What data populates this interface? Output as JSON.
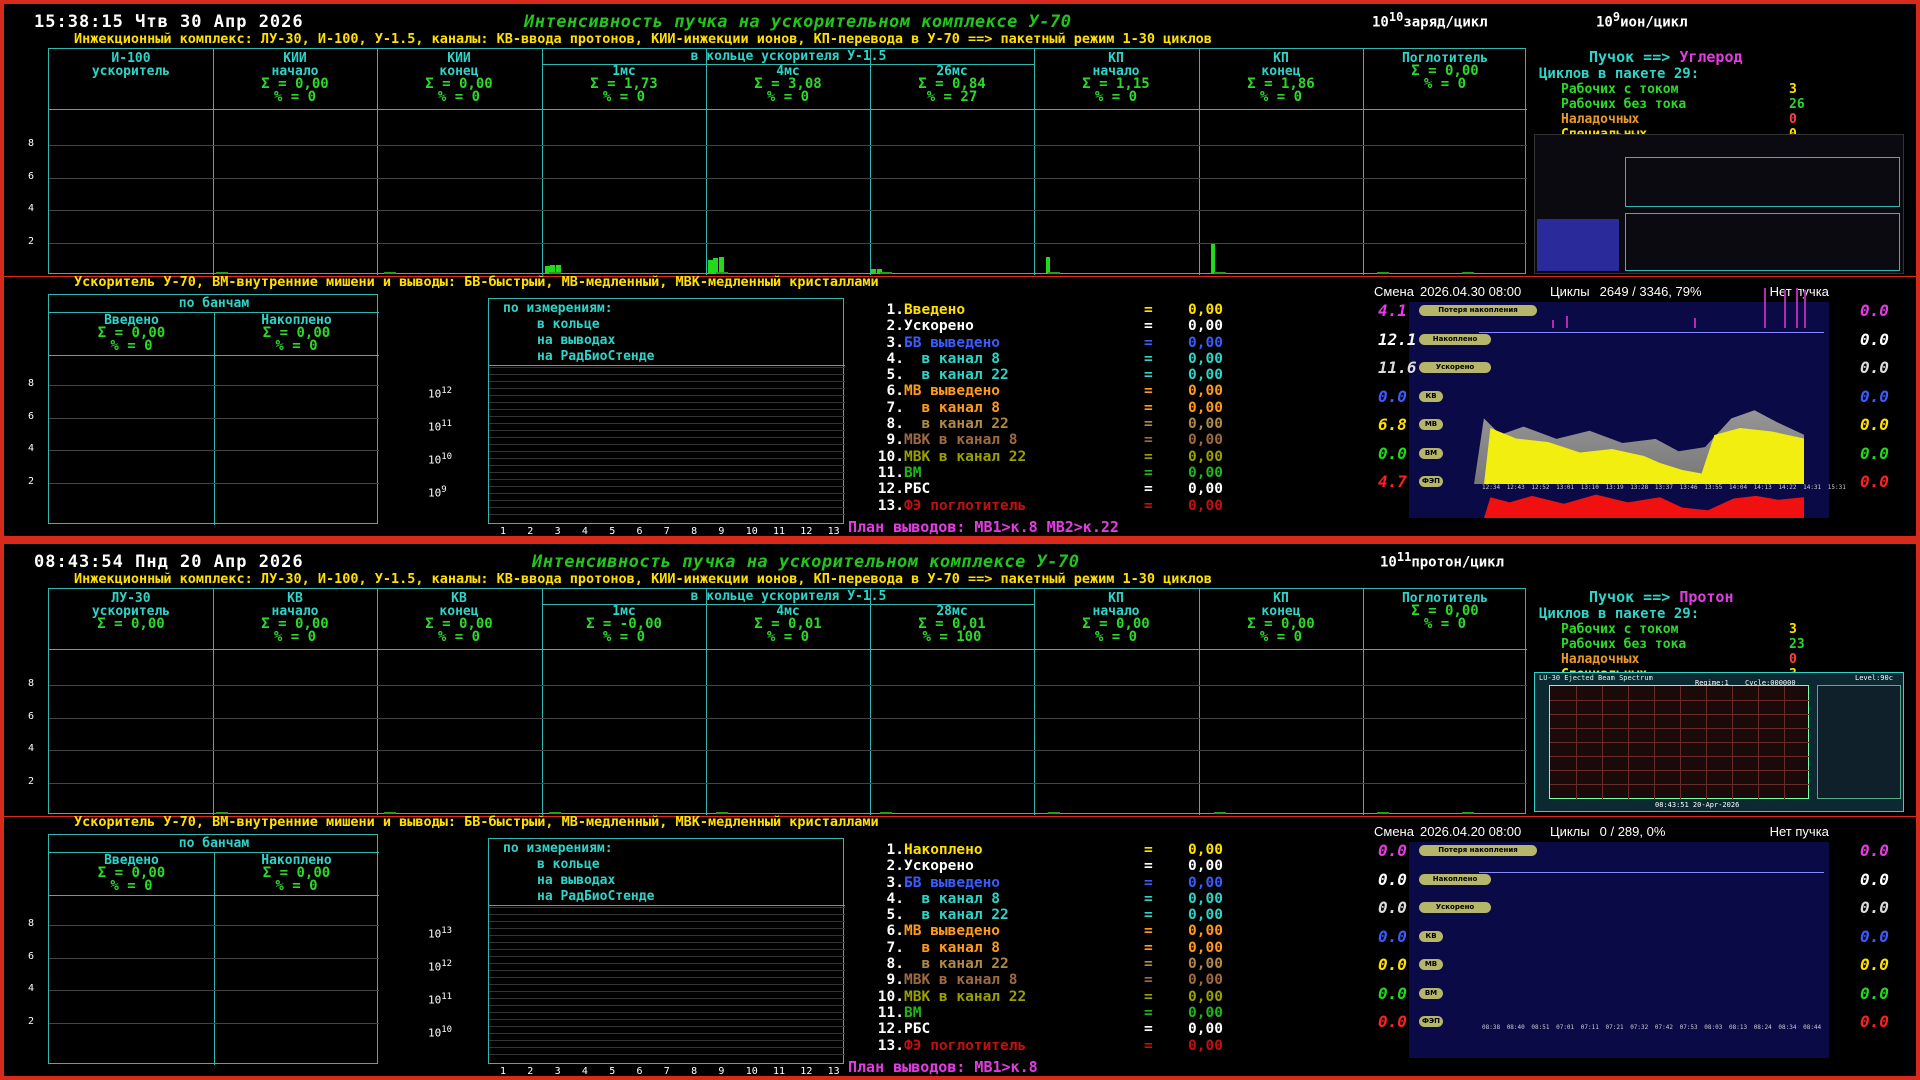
{
  "colors": {
    "frame": "#d82a1c",
    "green": "#22c51d",
    "cyan": "#2fd3c8",
    "yellow": "#ffe000",
    "magenta": "#e23de0"
  },
  "panels": [
    {
      "time": "15:38:15 Чтв 30 Апр 2026",
      "title": "Интенсивность пучка на ускорительном комплексе У-70",
      "unit1_base": "10",
      "unit1_exp": "10",
      "unit1_label": "заряд/цикл",
      "unit2_base": "10",
      "unit2_exp": "9",
      "unit2_label": "ион/цикл",
      "inj_line": "Инжекционный комплекс: ЛУ-30, И-100, У-1.5, каналы: КВ-ввода протонов, КИИ-инжекции ионов, КП-перевода в У-70 ==> пакетный режим 1-30 циклов",
      "ring_header": "в кольце ускорителя У-1.5",
      "columns": [
        {
          "name1": "И-100",
          "name2": "ускоритель",
          "sum": "",
          "pct": ""
        },
        {
          "name1": "КИИ",
          "name2": "начало",
          "sum": "Σ = 0,00",
          "pct": "% =   0"
        },
        {
          "name1": "КИИ",
          "name2": "конец",
          "sum": "Σ = 0,00",
          "pct": "% =   0"
        },
        {
          "name1": "",
          "name2": "1мс",
          "sum": "Σ = 1,73",
          "pct": "% =   0"
        },
        {
          "name1": "",
          "name2": "4мс",
          "sum": "Σ = 3,08",
          "pct": "% =   0"
        },
        {
          "name1": "",
          "name2": "26мс",
          "sum": "Σ = 0,84",
          "pct": "% =  27"
        },
        {
          "name1": "КП",
          "name2": "начало",
          "sum": "Σ = 1,15",
          "pct": "% =   0"
        },
        {
          "name1": "КП",
          "name2": "конец",
          "sum": "Σ = 1,86",
          "pct": "% =   0"
        },
        {
          "name1": "Поглотитель",
          "name2": "",
          "sum": "Σ = 0,00",
          "pct": "% =   0"
        }
      ],
      "y_ticks": [
        "8",
        "6",
        "4",
        "2"
      ],
      "beam": {
        "label": "Пучок ==> ",
        "particle": "Углерод"
      },
      "cycles": {
        "title": "Циклов в пакете 29:",
        "rows": [
          {
            "label": "Рабочих с током",
            "value": "3",
            "color": "#ffe000",
            "lcolor": "#2cd82a"
          },
          {
            "label": "Рабочих без тока",
            "value": "26",
            "color": "#2cd82a",
            "lcolor": "#2cd82a"
          },
          {
            "label": "Наладочных",
            "value": "0",
            "color": "#ff4040",
            "lcolor": "#e79a2a"
          },
          {
            "label": "Специальных",
            "value": "0",
            "color": "#ffe000",
            "lcolor": "#ffe000"
          }
        ]
      },
      "acc_line": "Ускоритель У-70, ВМ-внутренние мишени и выводы: БВ-быстрый, МВ-медленный, МВК-медленный кристаллами",
      "bunches": {
        "title": "по банчам",
        "col1": "Введено",
        "col2": "Накоплено",
        "sum1": "Σ = 0,00",
        "pct1": "% =   0",
        "sum2": "Σ = 0,00",
        "pct2": "% =   0"
      },
      "meas": {
        "title": "по измерениям:",
        "l1": "в кольце",
        "l2": "на выводах",
        "l3": "на РадБиоСтенде"
      },
      "log_exps": [
        "12",
        "11",
        "10",
        "9"
      ],
      "x_ticks": [
        "1",
        "2",
        "3",
        "4",
        "5",
        "6",
        "7",
        "8",
        "9",
        "10",
        "11",
        "12",
        "13"
      ],
      "list": [
        {
          "n": "1.",
          "label": "Введено",
          "val": "0,00",
          "c": "#ffe000"
        },
        {
          "n": "2.",
          "label": "Ускорено",
          "val": "0,00",
          "c": "#ffffff"
        },
        {
          "n": "3.",
          "label": "БВ выведено",
          "val": "0,00",
          "c": "#3a5cff"
        },
        {
          "n": "4.",
          "label": "  в канал 8",
          "val": "0,00",
          "c": "#2fd3c8"
        },
        {
          "n": "5.",
          "label": "  в канал 22",
          "val": "0,00",
          "c": "#2fd3c8"
        },
        {
          "n": "6.",
          "label": "МВ выведено",
          "val": "0,00",
          "c": "#ff9a1c"
        },
        {
          "n": "7.",
          "label": "  в канал 8",
          "val": "0,00",
          "c": "#ff9a1c"
        },
        {
          "n": "8.",
          "label": "  в канал 22",
          "val": "0,00",
          "c": "#b0884a"
        },
        {
          "n": "9.",
          "label": "МВК в канал 8",
          "val": "0,00",
          "c": "#a06a40"
        },
        {
          "n": "10.",
          "label": "МВК в канал 22",
          "val": "0,00",
          "c": "#9aa000"
        },
        {
          "n": "11.",
          "label": "ВМ",
          "val": "0,00",
          "c": "#1eb81a"
        },
        {
          "n": "12.",
          "label": "РБС",
          "val": "0,00",
          "c": "#ffffff"
        },
        {
          "n": "13.",
          "label": "ФЭ поглотитель",
          "val": "0,00",
          "c": "#c01010"
        }
      ],
      "plan": "План выводов: МВ1>к.8 МВ2>к.22",
      "shift": {
        "label": "Смена",
        "date": "2026.04.30 08:00",
        "cyc_label": "Циклы",
        "cyc": "2649 / 3346,  79%",
        "status": "Нет пучка"
      },
      "plot_rows": [
        {
          "left": "4.1",
          "pill": "Потеря накопления",
          "right": "0.0",
          "lc": "#e23de0",
          "rc": "#e23de0"
        },
        {
          "left": "12.1",
          "pill": "Накоплено",
          "right": "0.0",
          "lc": "#ffffff",
          "rc": "#ffffff"
        },
        {
          "left": "11.6",
          "pill": "Ускорено",
          "right": "0.0",
          "lc": "#dddddd",
          "rc": "#dddddd"
        },
        {
          "left": "0.0",
          "pill": "КВ",
          "right": "0.0",
          "lc": "#3a5cff",
          "rc": "#3a5cff"
        },
        {
          "left": "6.8",
          "pill": "МВ",
          "right": "0.0",
          "lc": "#ffe000",
          "rc": "#ffe000"
        },
        {
          "left": "0.0",
          "pill": "ВМ",
          "right": "0.0",
          "lc": "#22d91c",
          "rc": "#22d91c"
        },
        {
          "left": "4.7",
          "pill": "ФЭП",
          "right": "0.0",
          "lc": "#ff2020",
          "rc": "#ff2020"
        }
      ],
      "time_ticks": [
        "12:34",
        "12:43",
        "12:52",
        "13:01",
        "13:10",
        "13:19",
        "13:28",
        "13:37",
        "13:46",
        "13:55",
        "14:04",
        "14:13",
        "14:22",
        "14:31",
        "15:31"
      ]
    },
    {
      "time": "08:43:54 Пнд 20 Апр 2026",
      "title": "Интенсивность пучка на ускорительном комплексе У-70",
      "unit1_base": "10",
      "unit1_exp": "11",
      "unit1_label": "протон/цикл",
      "inj_line": "Инжекционный комплекс: ЛУ-30, И-100, У-1.5, каналы: КВ-ввода протонов, КИИ-инжекции ионов, КП-перевода в У-70 ==> пакетный режим 1-30 циклов",
      "ring_header": "в кольце ускорителя У-1.5",
      "columns": [
        {
          "name1": "ЛУ-30",
          "name2": "ускоритель",
          "sum": "Σ = 0,00",
          "pct": ""
        },
        {
          "name1": "КВ",
          "name2": "начало",
          "sum": "Σ = 0,00",
          "pct": "% =   0"
        },
        {
          "name1": "КВ",
          "name2": "конец",
          "sum": "Σ = 0,00",
          "pct": "% =   0"
        },
        {
          "name1": "",
          "name2": "1мс",
          "sum": "Σ = -0,00",
          "pct": "% =   0"
        },
        {
          "name1": "",
          "name2": "4мс",
          "sum": "Σ = 0,01",
          "pct": "% =   0"
        },
        {
          "name1": "",
          "name2": "28мс",
          "sum": "Σ = 0,01",
          "pct": "% = 100"
        },
        {
          "name1": "КП",
          "name2": "начало",
          "sum": "Σ = 0,00",
          "pct": "% =   0"
        },
        {
          "name1": "КП",
          "name2": "конец",
          "sum": "Σ = 0,00",
          "pct": "% =   0"
        },
        {
          "name1": "Поглотитель",
          "name2": "",
          "sum": "Σ = 0,00",
          "pct": "% =   0"
        }
      ],
      "y_ticks": [
        "8",
        "6",
        "4",
        "2"
      ],
      "beam": {
        "label": "Пучок ==> ",
        "particle": "Протон"
      },
      "cycles": {
        "title": "Циклов в пакете 29:",
        "rows": [
          {
            "label": "Рабочих с током",
            "value": "3",
            "color": "#ffe000",
            "lcolor": "#2cd82a"
          },
          {
            "label": "Рабочих без тока",
            "value": "23",
            "color": "#2cd82a",
            "lcolor": "#2cd82a"
          },
          {
            "label": "Наладочных",
            "value": "0",
            "color": "#ff4040",
            "lcolor": "#e79a2a"
          },
          {
            "label": "Специальных",
            "value": "3",
            "color": "#ffe000",
            "lcolor": "#ffe000"
          }
        ]
      },
      "spectrum": {
        "title": "LU-30 Ejected Beam Spectrum",
        "regime": "Regime:1",
        "cycle": "Cycle:000000",
        "level": "Level:90c",
        "stamp": "08:43:51 20-Apr-2026"
      },
      "acc_line": "Ускоритель У-70, ВМ-внутренние мишени и выводы: БВ-быстрый, МВ-медленный, МВК-медленный кристаллами",
      "bunches": {
        "title": "по банчам",
        "col1": "Введено",
        "col2": "Накоплено",
        "sum1": "Σ = 0,00",
        "pct1": "% =   0",
        "sum2": "Σ = 0,00",
        "pct2": "% =   0"
      },
      "meas": {
        "title": "по измерениям:",
        "l1": "в кольце",
        "l2": "на выводах",
        "l3": "на РадБиоСтенде"
      },
      "log_exps": [
        "13",
        "12",
        "11",
        "10"
      ],
      "x_ticks": [
        "1",
        "2",
        "3",
        "4",
        "5",
        "6",
        "7",
        "8",
        "9",
        "10",
        "11",
        "12",
        "13"
      ],
      "list": [
        {
          "n": "1.",
          "label": "Накоплено",
          "val": "0,00",
          "c": "#ffe000"
        },
        {
          "n": "2.",
          "label": "Ускорено",
          "val": "0,00",
          "c": "#ffffff"
        },
        {
          "n": "3.",
          "label": "БВ выведено",
          "val": "0,00",
          "c": "#3a5cff"
        },
        {
          "n": "4.",
          "label": "  в канал 8",
          "val": "0,00",
          "c": "#2fd3c8"
        },
        {
          "n": "5.",
          "label": "  в канал 22",
          "val": "0,00",
          "c": "#2fd3c8"
        },
        {
          "n": "6.",
          "label": "МВ выведено",
          "val": "0,00",
          "c": "#ff9a1c"
        },
        {
          "n": "7.",
          "label": "  в канал 8",
          "val": "0,00",
          "c": "#ff9a1c"
        },
        {
          "n": "8.",
          "label": "  в канал 22",
          "val": "0,00",
          "c": "#b0884a"
        },
        {
          "n": "9.",
          "label": "МВК в канал 8",
          "val": "0,00",
          "c": "#a06a40"
        },
        {
          "n": "10.",
          "label": "МВК в канал 22",
          "val": "0,00",
          "c": "#9aa000"
        },
        {
          "n": "11.",
          "label": "ВМ",
          "val": "0,00",
          "c": "#1eb81a"
        },
        {
          "n": "12.",
          "label": "РБС",
          "val": "0,00",
          "c": "#ffffff"
        },
        {
          "n": "13.",
          "label": "ФЭ поглотитель",
          "val": "0,00",
          "c": "#c01010"
        }
      ],
      "plan": "План выводов: МВ1>к.8",
      "shift": {
        "label": "Смена",
        "date": "2026.04.20 08:00",
        "cyc_label": "Циклы",
        "cyc": "0 /  289,   0%",
        "status": "Нет пучка"
      },
      "plot_rows": [
        {
          "left": "0.0",
          "pill": "Потеря накопления",
          "right": "0.0",
          "lc": "#e23de0",
          "rc": "#e23de0"
        },
        {
          "left": "0.0",
          "pill": "Накоплено",
          "right": "0.0",
          "lc": "#ffffff",
          "rc": "#ffffff"
        },
        {
          "left": "0.0",
          "pill": "Ускорено",
          "right": "0.0",
          "lc": "#dddddd",
          "rc": "#dddddd"
        },
        {
          "left": "0.0",
          "pill": "КВ",
          "right": "0.0",
          "lc": "#3a5cff",
          "rc": "#3a5cff"
        },
        {
          "left": "0.0",
          "pill": "МВ",
          "right": "0.0",
          "lc": "#ffe000",
          "rc": "#ffe000"
        },
        {
          "left": "0.0",
          "pill": "ВМ",
          "right": "0.0",
          "lc": "#22d91c",
          "rc": "#22d91c"
        },
        {
          "left": "0.0",
          "pill": "ФЭП",
          "right": "0.0",
          "lc": "#ff2020",
          "rc": "#ff2020"
        }
      ],
      "time_ticks": [
        "08:38",
        "08:40",
        "08:51",
        "07:01",
        "07:11",
        "07:21",
        "07:32",
        "07:42",
        "07:53",
        "08:03",
        "08:13",
        "08:24",
        "08:34",
        "08:44"
      ]
    }
  ]
}
